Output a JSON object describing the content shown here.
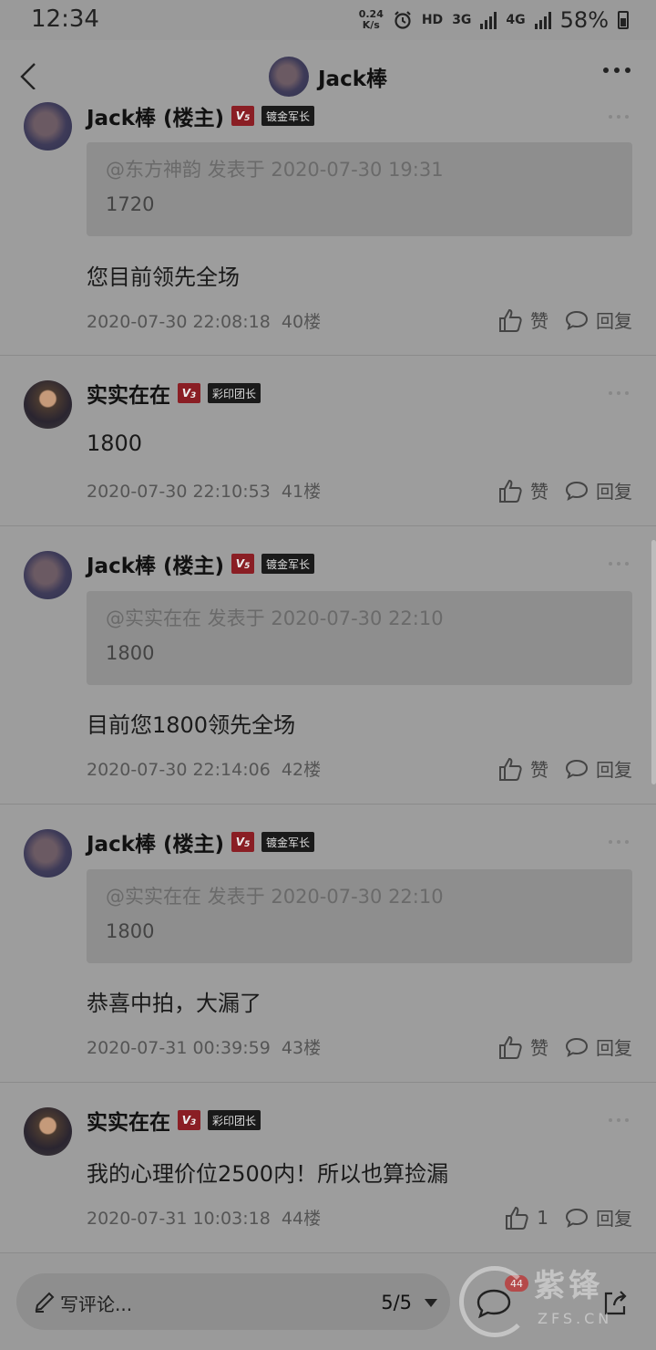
{
  "status_bar": {
    "time": "12:34",
    "net_speed_value": "0.24",
    "net_speed_unit": "K/s",
    "hd": "HD",
    "net1": "3G",
    "net2": "4G",
    "battery": "58%"
  },
  "header": {
    "title": "Jack棒"
  },
  "posts": [
    {
      "username": "Jack棒 (楼主)",
      "level": "V5",
      "level_text": "V",
      "level_num": "5",
      "badge": "镀金军长",
      "quote_header": "@东方神韵 发表于 2020-07-30 19:31",
      "quote_body": "1720",
      "content": "您目前领先全场",
      "timestamp": "2020-07-30 22:08:18",
      "floor": "40楼",
      "like_label": "赞",
      "reply_label": "回复"
    },
    {
      "username": "实实在在",
      "level": "V3",
      "level_text": "V",
      "level_num": "3",
      "badge": "彩印团长",
      "content": "1800",
      "timestamp": "2020-07-30 22:10:53",
      "floor": "41楼",
      "like_label": "赞",
      "reply_label": "回复"
    },
    {
      "username": "Jack棒 (楼主)",
      "level": "V5",
      "level_text": "V",
      "level_num": "5",
      "badge": "镀金军长",
      "quote_header": "@实实在在 发表于 2020-07-30 22:10",
      "quote_body": "1800",
      "content": "目前您1800领先全场",
      "timestamp": "2020-07-30 22:14:06",
      "floor": "42楼",
      "like_label": "赞",
      "reply_label": "回复"
    },
    {
      "username": "Jack棒 (楼主)",
      "level": "V5",
      "level_text": "V",
      "level_num": "5",
      "badge": "镀金军长",
      "quote_header": "@实实在在 发表于 2020-07-30 22:10",
      "quote_body": "1800",
      "content": "恭喜中拍，大漏了",
      "timestamp": "2020-07-31 00:39:59",
      "floor": "43楼",
      "like_label": "赞",
      "reply_label": "回复"
    },
    {
      "username": "实实在在",
      "level": "V3",
      "level_text": "V",
      "level_num": "3",
      "badge": "彩印团长",
      "content": "我的心理价位2500内！所以也算捡漏",
      "timestamp": "2020-07-31 10:03:18",
      "floor": "44楼",
      "like_label": "1",
      "reply_label": "回复"
    }
  ],
  "bottom_bar": {
    "comment_placeholder": "写评论...",
    "pager": "5/5",
    "comment_count": "44"
  },
  "watermark": {
    "brand": "紫锋",
    "domain": "ZFS.CN"
  },
  "icons": {
    "back": "chevron-left-icon",
    "more": "more-horizontal-icon",
    "like": "thumbs-up-icon",
    "reply": "speech-bubble-icon",
    "pen": "pen-icon",
    "share": "share-icon"
  }
}
